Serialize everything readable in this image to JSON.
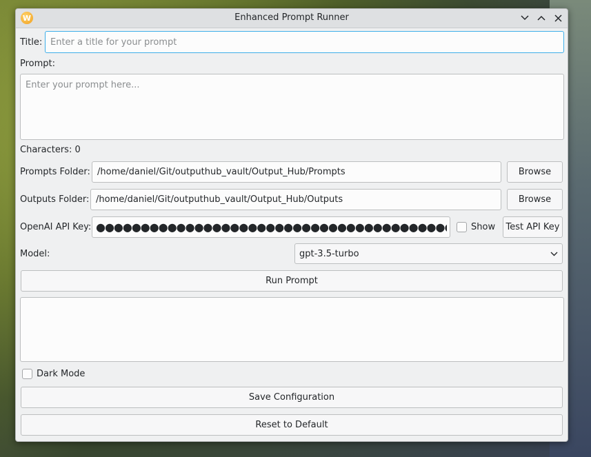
{
  "window": {
    "title": "Enhanced Prompt Runner",
    "app_icon_glyph": "W",
    "controls": {
      "minimize_icon": "chevron-down-icon",
      "maximize_icon": "chevron-up-icon",
      "close_icon": "close-icon"
    }
  },
  "form": {
    "title_label": "Title:",
    "title_placeholder": "Enter a title for your prompt",
    "prompt_label": "Prompt:",
    "prompt_placeholder": "Enter your prompt here...",
    "characters_label": "Characters: 0",
    "prompts_folder_label": "Prompts Folder:",
    "prompts_folder_value": "/home/daniel/Git/outputhub_vault/Output_Hub/Prompts",
    "outputs_folder_label": "Outputs Folder:",
    "outputs_folder_value": "/home/daniel/Git/outputhub_vault/Output_Hub/Outputs",
    "browse_label": "Browse",
    "api_key_label": "OpenAI API Key:",
    "api_key_masked": "●●●●●●●●●●●●●●●●●●●●●●●●●●●●●●●●●●●●●●●●●●●●●●●●●●●",
    "show_label": "Show",
    "show_checked": false,
    "test_api_key_label": "Test API Key",
    "model_label": "Model:",
    "model_selected": "gpt-3.5-turbo",
    "run_prompt_label": "Run Prompt",
    "output_text": "",
    "dark_mode_label": "Dark Mode",
    "dark_mode_checked": false,
    "save_config_label": "Save Configuration",
    "reset_label": "Reset to Default"
  },
  "colors": {
    "accent": "#3daee9",
    "window_bg": "#eff0f1",
    "titlebar_bg": "#dee0e2"
  }
}
